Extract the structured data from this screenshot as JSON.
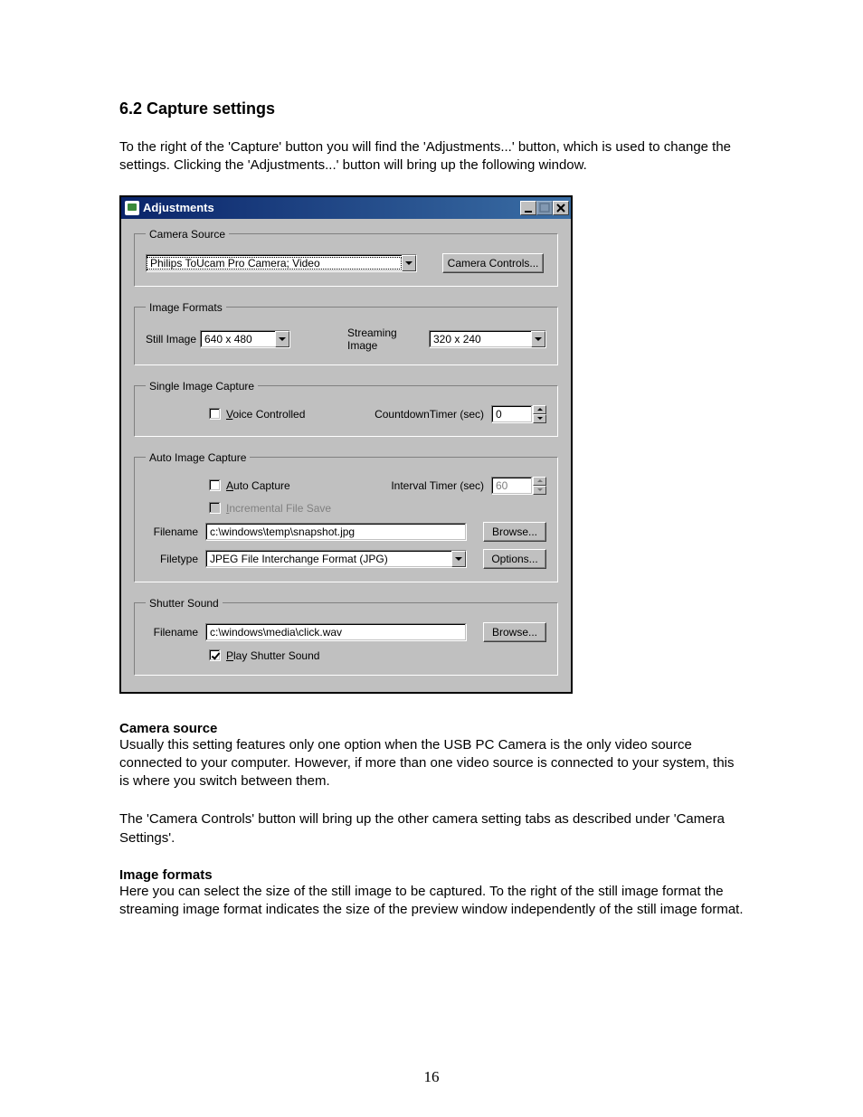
{
  "page": {
    "heading": "6.2 Capture settings",
    "intro": "To the right of the 'Capture' button you will find the 'Adjustments...' button, which is used to change the settings. Clicking the 'Adjustments...' button will bring up the following window.",
    "camera_source_head": "Camera source",
    "camera_source_text": "Usually this setting features only one option when the USB PC Camera is the only video source connected to your computer. However, if more than one video source is connected to your system, this is where you switch between them.",
    "camera_controls_text": "The 'Camera Controls' button will bring up the other camera setting tabs as described under 'Camera Settings'.",
    "image_formats_head": "Image formats",
    "image_formats_text": "Here you can select the size of the still image to be captured. To the right of the still image format the streaming image format indicates the size of the preview window independently of the still image format.",
    "page_number": "16"
  },
  "window": {
    "title": "Adjustments",
    "groups": {
      "camera_source": {
        "legend": "Camera Source",
        "select_value": "Philips ToUcam Pro Camera; Video",
        "controls_btn": "Camera Controls..."
      },
      "image_formats": {
        "legend": "Image Formats",
        "still_label": "Still Image",
        "still_value": "640 x 480",
        "stream_label": "Streaming Image",
        "stream_value": "320 x 240"
      },
      "single_capture": {
        "legend": "Single Image Capture",
        "voice_label": "Voice Controlled",
        "countdown_label": "CountdownTimer (sec)",
        "countdown_value": "0"
      },
      "auto_capture": {
        "legend": "Auto Image Capture",
        "auto_label": "Auto Capture",
        "interval_label": "Interval Timer (sec)",
        "interval_value": "60",
        "incremental_label": "Incremental File Save",
        "filename_label": "Filename",
        "filename_value": "c:\\windows\\temp\\snapshot.jpg",
        "browse_btn": "Browse...",
        "filetype_label": "Filetype",
        "filetype_value": "JPEG File Interchange Format (JPG)",
        "options_btn": "Options..."
      },
      "shutter": {
        "legend": "Shutter Sound",
        "filename_label": "Filename",
        "filename_value": "c:\\windows\\media\\click.wav",
        "browse_btn": "Browse...",
        "play_label": "Play Shutter Sound"
      }
    }
  }
}
